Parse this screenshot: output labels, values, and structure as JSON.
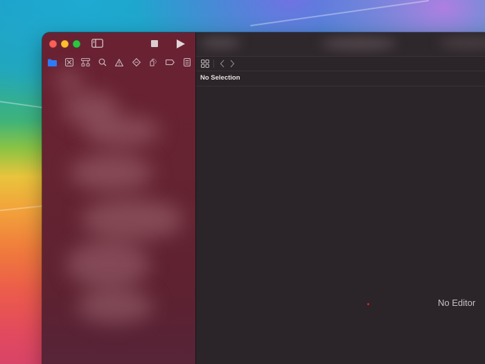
{
  "window": {
    "traffic_lights": {
      "close_color": "#fe5f57",
      "minimize_color": "#febc2e",
      "zoom_color": "#28c840"
    },
    "toolbar": {
      "sidebar_toggle_icon": "sidebar-toggle-icon",
      "stop_icon": "stop-icon",
      "run_icon": "play-icon"
    },
    "navigator_tabs": [
      {
        "icon": "folder-icon",
        "active": true,
        "color": "#2d7cf6"
      },
      {
        "icon": "source-control-icon",
        "active": false
      },
      {
        "icon": "symbol-hierarchy-icon",
        "active": false
      },
      {
        "icon": "search-icon",
        "active": false
      },
      {
        "icon": "warning-icon",
        "active": false
      },
      {
        "icon": "test-diamond-icon",
        "active": false
      },
      {
        "icon": "debug-spray-icon",
        "active": false
      },
      {
        "icon": "breakpoint-icon",
        "active": false
      },
      {
        "icon": "report-icon",
        "active": false
      }
    ],
    "editor": {
      "grid_icon": "grid-icon",
      "back_icon": "chevron-left-icon",
      "forward_icon": "chevron-right-icon",
      "selection_label": "No Selection",
      "empty_label": "No Editor",
      "accent_red": "#d6252c"
    },
    "colors": {
      "sidebar_bg": "#662331",
      "editor_bg": "#2b2428",
      "active_tab": "#2d7cf6"
    }
  }
}
